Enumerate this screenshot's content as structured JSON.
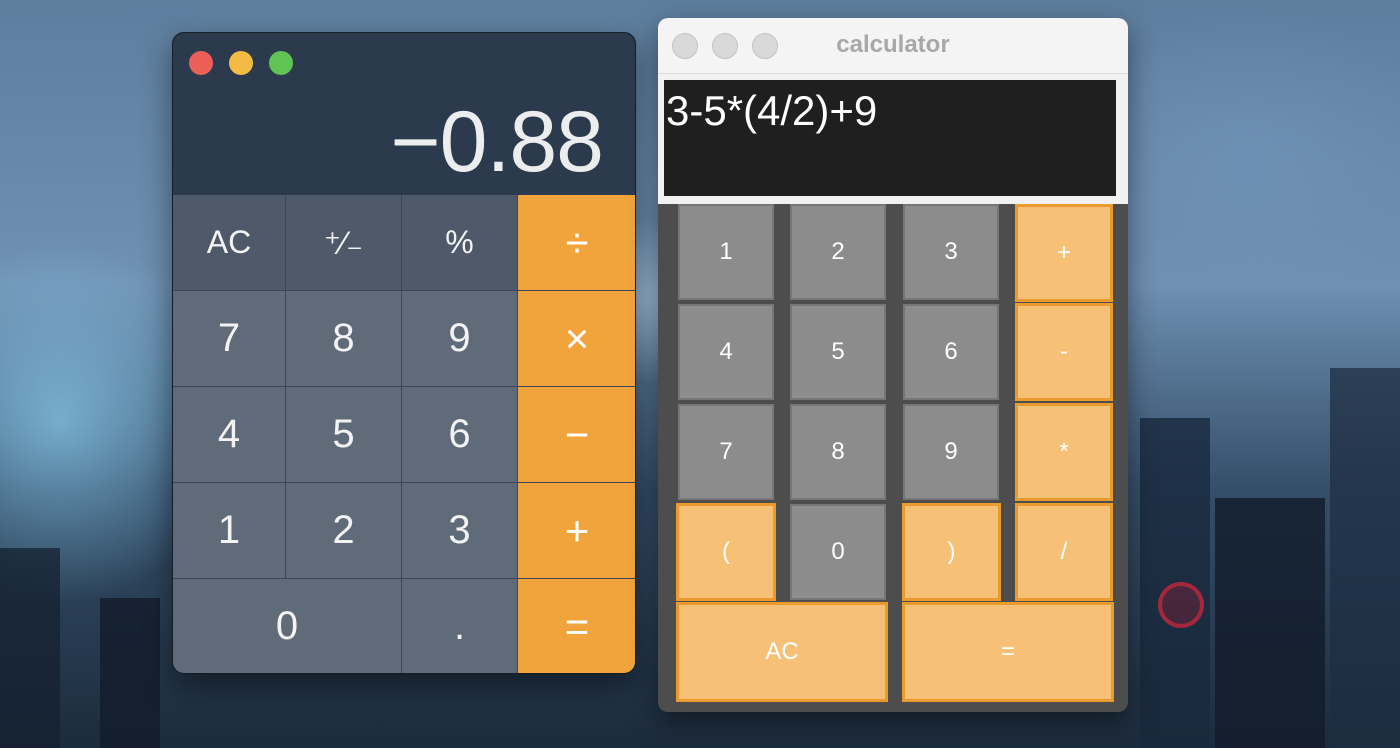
{
  "mac_calculator": {
    "display_value": "−0.88",
    "keys": {
      "ac": "AC",
      "sign": "⁺⁄₋",
      "percent": "%",
      "divide": "÷",
      "seven": "7",
      "eight": "8",
      "nine": "9",
      "multiply": "×",
      "four": "4",
      "five": "5",
      "six": "6",
      "minus": "−",
      "one": "1",
      "two": "2",
      "three": "3",
      "plus": "+",
      "zero": "0",
      "decimal": ".",
      "equals": "="
    },
    "colors": {
      "operator": "#f1a33c",
      "digit": "#5f6b79",
      "function": "#4e5a69",
      "body": "#2b3a4d"
    }
  },
  "tk_calculator": {
    "title": "calculator",
    "expression": "3-5*(4/2)+9",
    "keys": {
      "one": "1",
      "two": "2",
      "three": "3",
      "plus": "+",
      "four": "4",
      "five": "5",
      "six": "6",
      "minus": "-",
      "seven": "7",
      "eight": "8",
      "nine": "9",
      "multiply": "*",
      "lparen": "(",
      "zero": "0",
      "rparen": ")",
      "divide": "/",
      "clear": "AC",
      "equals": "="
    },
    "colors": {
      "operator": "#f6c177",
      "operator_border": "#e99b2e",
      "digit": "#8c8c8c",
      "body": "#4d4d4d"
    }
  }
}
